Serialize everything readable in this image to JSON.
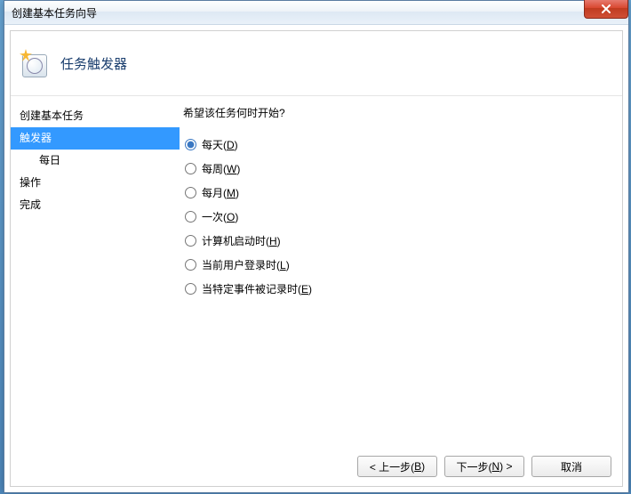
{
  "window": {
    "title": "创建基本任务向导"
  },
  "header": {
    "title": "任务触发器"
  },
  "sidebar": {
    "items": [
      {
        "label": "创建基本任务",
        "selected": false,
        "indent": false
      },
      {
        "label": "触发器",
        "selected": true,
        "indent": false
      },
      {
        "label": "每日",
        "selected": false,
        "indent": true
      },
      {
        "label": "操作",
        "selected": false,
        "indent": false
      },
      {
        "label": "完成",
        "selected": false,
        "indent": false
      }
    ]
  },
  "content": {
    "prompt": "希望该任务何时开始?",
    "options": [
      {
        "label": "每天",
        "accel": "D",
        "checked": true
      },
      {
        "label": "每周",
        "accel": "W",
        "checked": false
      },
      {
        "label": "每月",
        "accel": "M",
        "checked": false
      },
      {
        "label": "一次",
        "accel": "O",
        "checked": false
      },
      {
        "label": "计算机启动时",
        "accel": "H",
        "checked": false
      },
      {
        "label": "当前用户登录时",
        "accel": "L",
        "checked": false
      },
      {
        "label": "当特定事件被记录时",
        "accel": "E",
        "checked": false
      }
    ]
  },
  "footer": {
    "back": {
      "prefix": "< 上一步(",
      "accel": "B",
      "suffix": ")"
    },
    "next": {
      "prefix": "下一步(",
      "accel": "N",
      "suffix": ") >"
    },
    "cancel": {
      "label": "取消"
    }
  }
}
